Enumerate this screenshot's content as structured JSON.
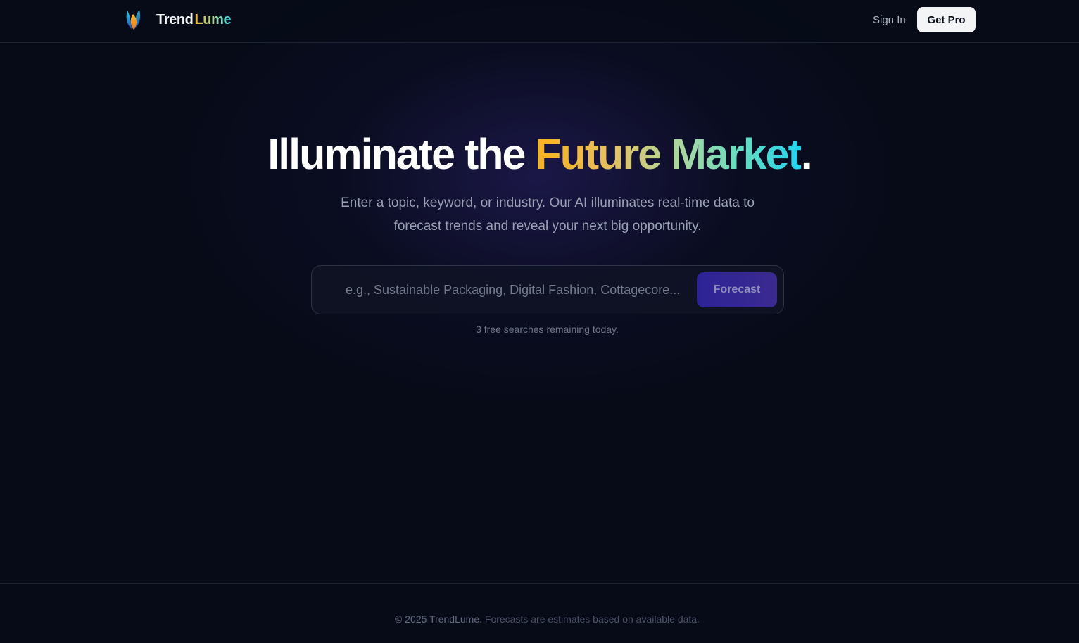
{
  "header": {
    "brand_part1": "Trend",
    "brand_part2": "Lume",
    "logo_icon": "flame-leaf-logo-icon",
    "signin_label": "Sign In",
    "getpro_label": "Get Pro"
  },
  "hero": {
    "title_part1": "Illuminate the ",
    "title_highlight": "Future Market",
    "title_end": ".",
    "subtitle": "Enter a topic, keyword, or industry. Our AI illuminates real-time data to forecast trends and reveal your next big opportunity."
  },
  "search": {
    "value": "",
    "placeholder": "e.g., Sustainable Packaging, Digital Fashion, Cottagecore...",
    "button_label": "Forecast",
    "remaining_text": "3 free searches remaining today."
  },
  "footer": {
    "copyright": "© 2025 TrendLume.",
    "disclaimer": " Forecasts are estimates based on available data."
  },
  "colors": {
    "background": "#070b18",
    "gradient_start": "#f8b21a",
    "gradient_end": "#1fd3ef",
    "button_purple": "#2d2396"
  }
}
